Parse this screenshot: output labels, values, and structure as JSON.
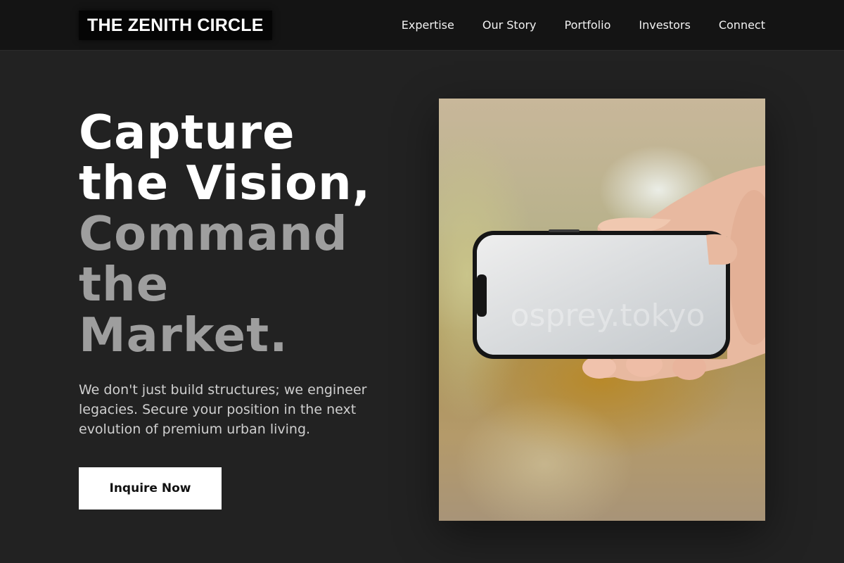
{
  "brand": {
    "name": "THE ZENITH CIRCLE"
  },
  "nav": {
    "items": [
      {
        "label": "Expertise"
      },
      {
        "label": "Our Story"
      },
      {
        "label": "Portfolio"
      },
      {
        "label": "Investors"
      },
      {
        "label": "Connect"
      }
    ]
  },
  "hero": {
    "title_line_1": "Capture",
    "title_line_2": "the Vision,",
    "title_line_3": "Command",
    "title_line_4": "the",
    "title_line_5": "Market.",
    "subtitle": "We don't just build structures; we engineer legacies. Secure your position in the next evolution of premium urban living.",
    "cta_label": "Inquire Now",
    "image": {
      "watermark": "osprey.tokyo"
    }
  },
  "colors": {
    "background": "#222222",
    "header": "#141414",
    "accent_grey": "#9e9e9e",
    "button_bg": "#ffffff"
  }
}
